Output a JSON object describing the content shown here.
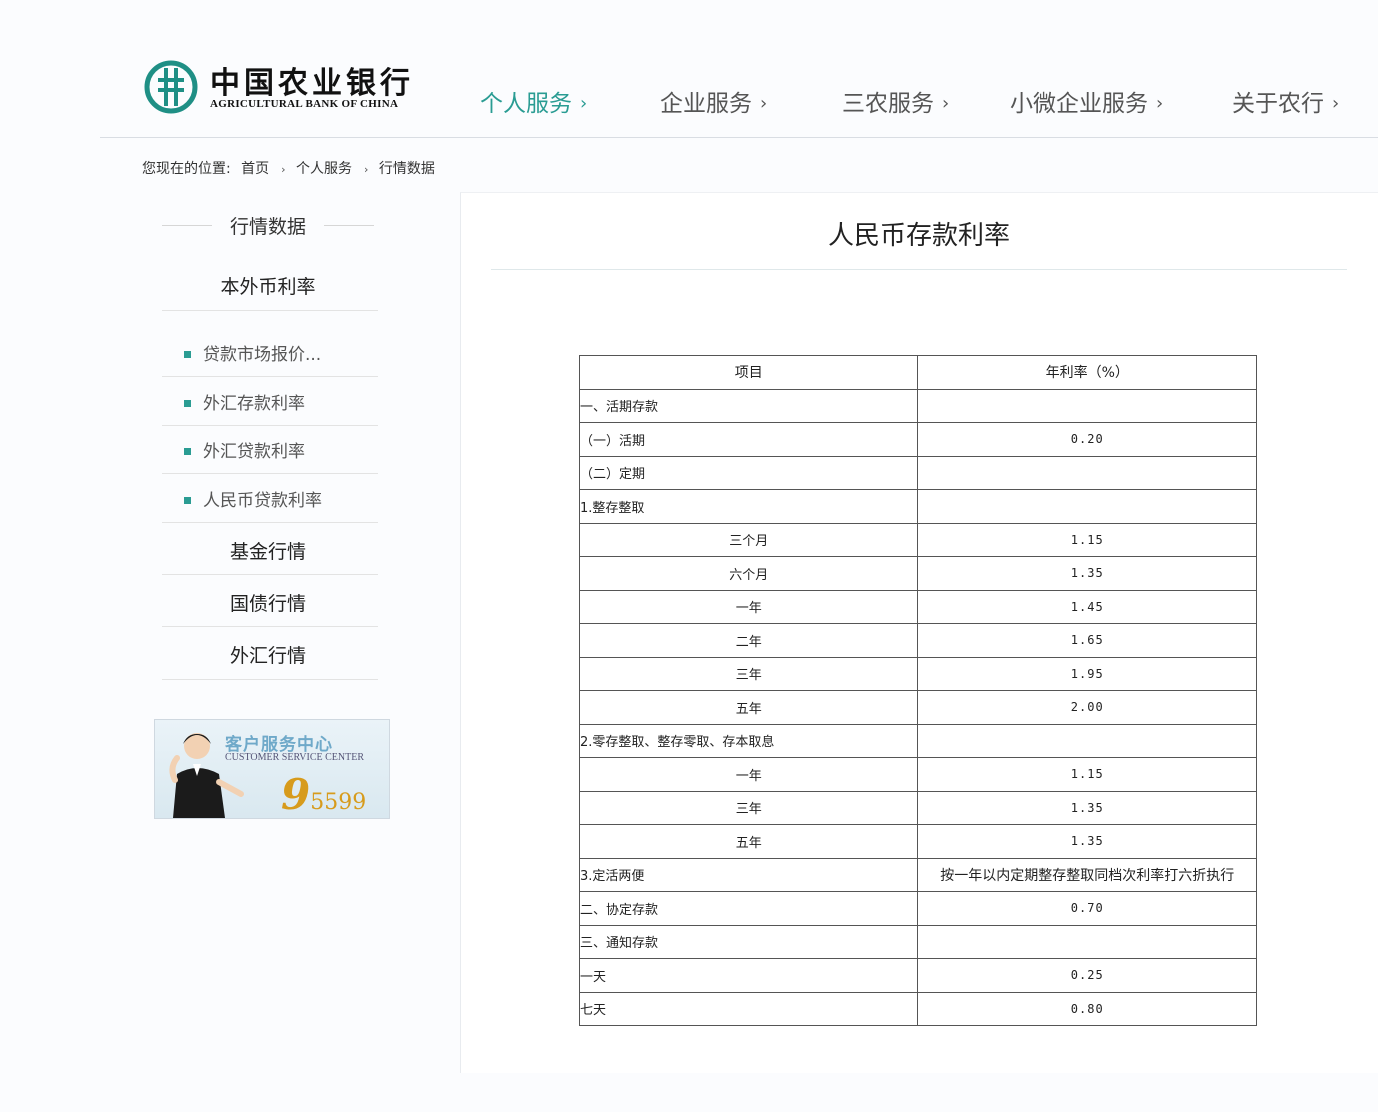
{
  "brand": {
    "name_cn": "中国农业银行",
    "name_en": "AGRICULTURAL BANK OF CHINA",
    "accent_color": "#2a9c93"
  },
  "nav": {
    "items": [
      {
        "label": "个人服务",
        "chevron": "›",
        "active": true
      },
      {
        "label": "企业服务",
        "chevron": "›",
        "active": false
      },
      {
        "label": "三农服务",
        "chevron": "›",
        "active": false
      },
      {
        "label": "小微企业服务",
        "chevron": "›",
        "active": false
      },
      {
        "label": "关于农行",
        "chevron": "›",
        "active": false
      }
    ]
  },
  "breadcrumb": {
    "prefix": "您现在的位置:",
    "items": [
      "首页",
      "个人服务",
      "行情数据"
    ],
    "separator": "›"
  },
  "sidebar": {
    "title": "行情数据",
    "subtitle": "本外币利率",
    "links": [
      "贷款市场报价...",
      "外汇存款利率",
      "外汇贷款利率",
      "人民币贷款利率"
    ],
    "categories": [
      "基金行情",
      "国债行情",
      "外汇行情"
    ],
    "banner": {
      "cn": "客户服务中心",
      "en": "CUSTOMER SERVICE CENTER",
      "number_big": "9",
      "number_small": "5599"
    }
  },
  "content": {
    "title": "人民币存款利率",
    "table": {
      "headers": [
        "项目",
        "年利率（%）"
      ],
      "rows": [
        {
          "item": "一、活期存款",
          "rate": ""
        },
        {
          "item": "（一）活期",
          "rate": "0.20"
        },
        {
          "item": "（二）定期",
          "rate": ""
        },
        {
          "item": "1.整存整取",
          "rate": ""
        },
        {
          "item": "三个月",
          "rate": "1.15"
        },
        {
          "item": "六个月",
          "rate": "1.35"
        },
        {
          "item": "一年",
          "rate": "1.45"
        },
        {
          "item": "二年",
          "rate": "1.65"
        },
        {
          "item": "三年",
          "rate": "1.95"
        },
        {
          "item": "五年",
          "rate": "2.00"
        },
        {
          "item": "2.零存整取、整存零取、存本取息",
          "rate": ""
        },
        {
          "item": "一年",
          "rate": "1.15"
        },
        {
          "item": "三年",
          "rate": "1.35"
        },
        {
          "item": "五年",
          "rate": "1.35"
        },
        {
          "item": "3.定活两便",
          "rate": "按一年以内定期整存整取同档次利率打六折执行"
        },
        {
          "item": "二、协定存款",
          "rate": "0.70"
        },
        {
          "item": "三、通知存款",
          "rate": ""
        },
        {
          "item": "一天",
          "rate": "0.25"
        },
        {
          "item": "七天",
          "rate": "0.80"
        }
      ]
    }
  }
}
